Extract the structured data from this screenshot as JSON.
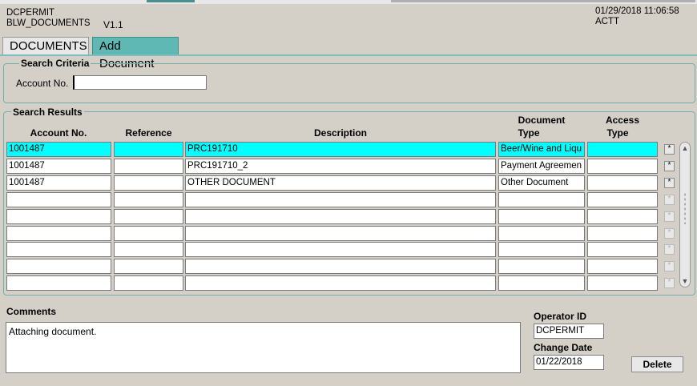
{
  "header": {
    "app_id": "DCPERMIT",
    "form_name": "BLW_DOCUMENTS",
    "version": "V1.1",
    "datetime": "01/29/2018 11:06:58",
    "user": "ACTT"
  },
  "tabs": [
    {
      "label": "DOCUMENTS"
    },
    {
      "label": "Add Document"
    }
  ],
  "search": {
    "legend": "Search Criteria",
    "account_label": "Account No.",
    "account_value": ""
  },
  "results": {
    "legend": "Search Results",
    "columns": {
      "account": "Account No.",
      "reference": "Reference",
      "description": "Description",
      "doc_type_1": "Document",
      "doc_type_2": "Type",
      "access_type_1": "Access",
      "access_type_2": "Type"
    },
    "row_button_glyph": "*",
    "rows": [
      {
        "account": "1001487",
        "reference": "",
        "description": "PRC191710",
        "doc_type": "Beer/Wine and Liqu",
        "access_type": ""
      },
      {
        "account": "1001487",
        "reference": "",
        "description": "PRC191710_2",
        "doc_type": "Payment Agreemen",
        "access_type": ""
      },
      {
        "account": "1001487",
        "reference": "",
        "description": "OTHER DOCUMENT",
        "doc_type": "Other Document",
        "access_type": ""
      },
      {
        "account": "",
        "reference": "",
        "description": "",
        "doc_type": "",
        "access_type": ""
      },
      {
        "account": "",
        "reference": "",
        "description": "",
        "doc_type": "",
        "access_type": ""
      },
      {
        "account": "",
        "reference": "",
        "description": "",
        "doc_type": "",
        "access_type": ""
      },
      {
        "account": "",
        "reference": "",
        "description": "",
        "doc_type": "",
        "access_type": ""
      },
      {
        "account": "",
        "reference": "",
        "description": "",
        "doc_type": "",
        "access_type": ""
      },
      {
        "account": "",
        "reference": "",
        "description": "",
        "doc_type": "",
        "access_type": ""
      }
    ],
    "selected_row": 0
  },
  "comments": {
    "label": "Comments",
    "value": "Attaching document."
  },
  "operator": {
    "label": "Operator ID",
    "value": "DCPERMIT"
  },
  "change_date": {
    "label": "Change Date",
    "value": "01/22/2018"
  },
  "actions": {
    "delete_label": "Delete"
  },
  "colors": {
    "background": "#d4d0c8",
    "accent_teal": "#5fb8b3",
    "selected_row": "#00ffff"
  }
}
